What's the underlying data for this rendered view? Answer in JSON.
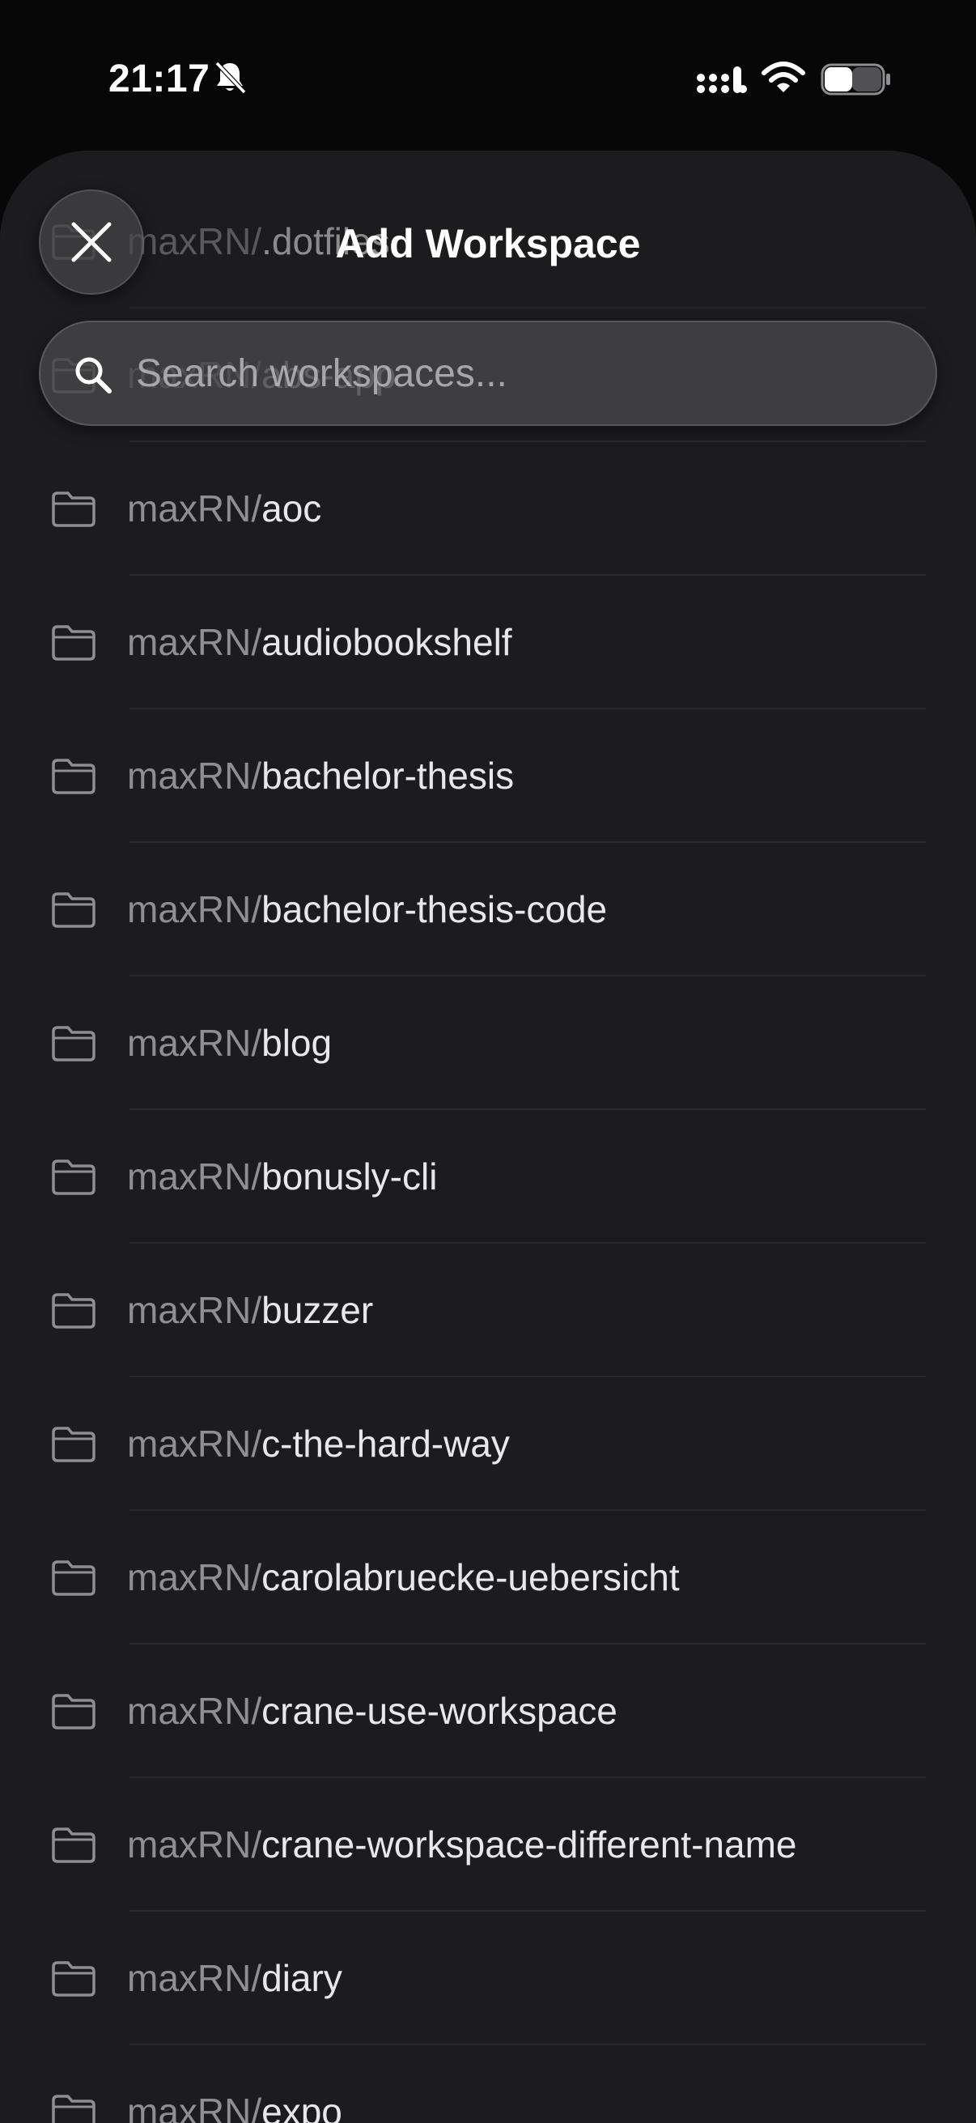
{
  "status_bar": {
    "time": "21:17",
    "icons": [
      "bell-slash-icon",
      "signal-icon",
      "wifi-icon",
      "battery-icon"
    ]
  },
  "sheet": {
    "title": "Add Workspace",
    "close_icon": "close-icon",
    "search": {
      "placeholder": "Search workspaces...",
      "value": "",
      "icon": "search-icon"
    }
  },
  "workspaces": [
    {
      "owner": "maxRN/",
      "repo": ".dotfiles"
    },
    {
      "owner": "maxRN/",
      "repo": "abs-app"
    },
    {
      "owner": "maxRN/",
      "repo": "aoc"
    },
    {
      "owner": "maxRN/",
      "repo": "audiobookshelf"
    },
    {
      "owner": "maxRN/",
      "repo": "bachelor-thesis"
    },
    {
      "owner": "maxRN/",
      "repo": "bachelor-thesis-code"
    },
    {
      "owner": "maxRN/",
      "repo": "blog"
    },
    {
      "owner": "maxRN/",
      "repo": "bonusly-cli"
    },
    {
      "owner": "maxRN/",
      "repo": "buzzer"
    },
    {
      "owner": "maxRN/",
      "repo": "c-the-hard-way"
    },
    {
      "owner": "maxRN/",
      "repo": "carolabruecke-uebersicht"
    },
    {
      "owner": "maxRN/",
      "repo": "crane-use-workspace"
    },
    {
      "owner": "maxRN/",
      "repo": "crane-workspace-different-name"
    },
    {
      "owner": "maxRN/",
      "repo": "diary"
    },
    {
      "owner": "maxRN/",
      "repo": "expo"
    }
  ],
  "colors": {
    "background": "#070707",
    "sheet": "#1c1c1e",
    "owner_text": "#8e8e93",
    "repo_text": "#e8e8ea",
    "divider": "#2a2a2c"
  }
}
